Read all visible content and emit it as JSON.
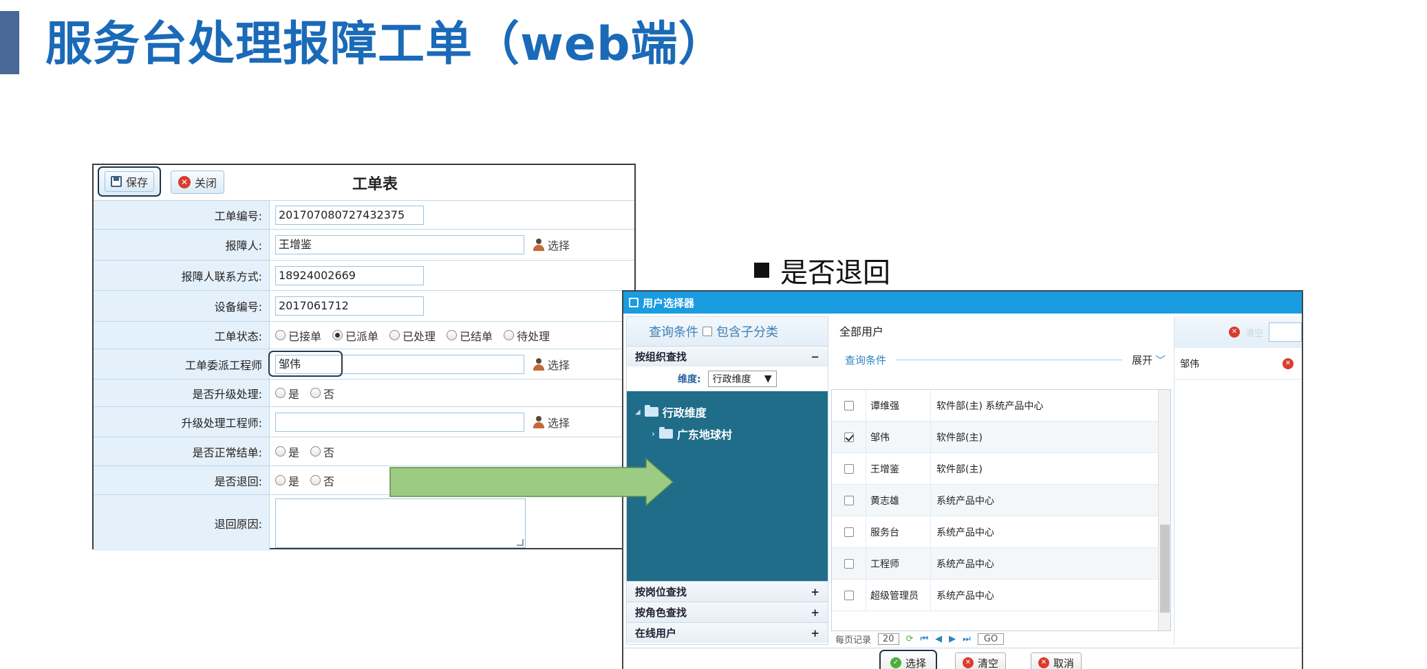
{
  "slide": {
    "title": "服务台处理报障工单（web端）",
    "bullet": "是否退回"
  },
  "work_order": {
    "title": "工单表",
    "toolbar": {
      "save_label": "保存",
      "close_label": "关闭"
    },
    "fields": {
      "order_no": {
        "label": "工单编号:",
        "value": "201707080727432375"
      },
      "reporter": {
        "label": "报障人:",
        "value": "王增鉴",
        "pick_label": "选择"
      },
      "reporter_contact": {
        "label": "报障人联系方式:",
        "value": "18924002669"
      },
      "device_no": {
        "label": "设备编号:",
        "value": "2017061712"
      },
      "status": {
        "label": "工单状态:",
        "options": [
          "已接单",
          "已派单",
          "已处理",
          "已结单",
          "待处理"
        ],
        "selected": "已派单"
      },
      "engineer": {
        "label": "工单委派工程师",
        "value": "邹伟",
        "pick_label": "选择"
      },
      "upgrade": {
        "label": "是否升级处理:",
        "options": [
          "是",
          "否"
        ]
      },
      "upgrade_engineer": {
        "label": "升级处理工程师:",
        "value": "",
        "pick_label": "选择"
      },
      "normal_close": {
        "label": "是否正常结单:",
        "options": [
          "是",
          "否"
        ]
      },
      "returned": {
        "label": "是否退回:",
        "options": [
          "是",
          "否"
        ]
      },
      "return_reason": {
        "label": "退回原因:",
        "value": ""
      }
    }
  },
  "user_picker": {
    "title": "用户选择器",
    "left": {
      "query_label": "查询条件",
      "include_sub_label": "包含子分类",
      "by_org": "按组织查找",
      "by_org_toggle": "−",
      "dimension_label": "维度:",
      "dimension_value": "行政维度",
      "tree": {
        "root": "行政维度",
        "child": "广东地球村"
      },
      "by_post": "按岗位查找",
      "by_role": "按角色查找",
      "online": "在线用户",
      "plus": "+"
    },
    "middle": {
      "header": "全部用户",
      "query_label": "查询条件",
      "expand_label": "展开",
      "rows": [
        {
          "name": "谭维强",
          "org": "软件部(主) 系统产品中心",
          "checked": false
        },
        {
          "name": "邹伟",
          "org": "软件部(主)",
          "checked": true
        },
        {
          "name": "王增鉴",
          "org": "软件部(主)",
          "checked": false
        },
        {
          "name": "黄志雄",
          "org": "系统产品中心",
          "checked": false
        },
        {
          "name": "服务台",
          "org": "系统产品中心",
          "checked": false
        },
        {
          "name": "工程师",
          "org": "系统产品中心",
          "checked": false
        },
        {
          "name": "超级管理员",
          "org": "系统产品中心",
          "checked": false
        }
      ],
      "pager": {
        "per_page_label": "每页记录",
        "per_page_value": "20",
        "go_label": "GO"
      }
    },
    "right": {
      "clear_label": "清空",
      "selected": [
        {
          "name": "邹伟"
        }
      ]
    },
    "footer": {
      "select_label": "选择",
      "clear_label": "清空",
      "cancel_label": "取消"
    }
  },
  "colors": {
    "title": "#1a6ab8",
    "dialog_titlebar": "#1a9ce0",
    "tree_bg": "#206d8a",
    "arrow": "#9ccc84"
  }
}
